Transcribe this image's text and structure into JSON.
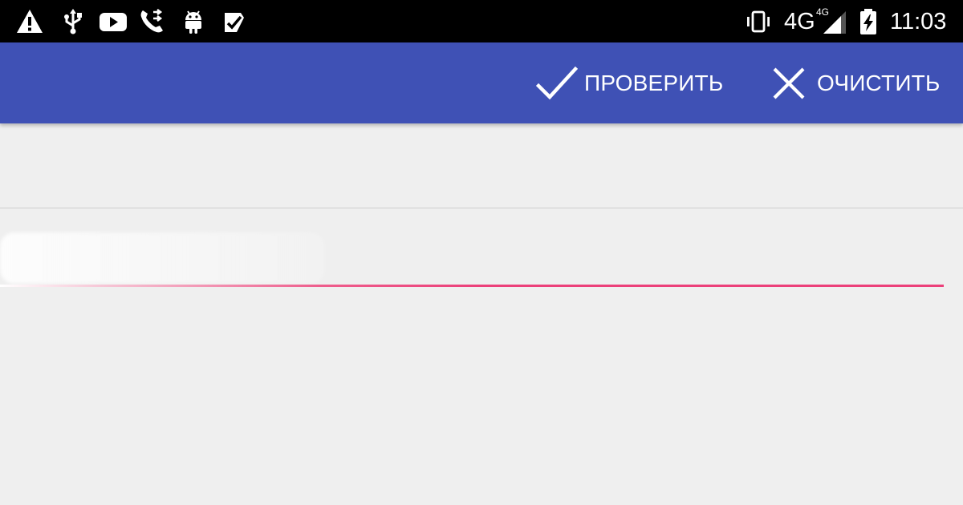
{
  "status_bar": {
    "network_label": "4G",
    "network_small_label": "4G",
    "time": "11:03",
    "icons": [
      "warning-icon",
      "usb-icon",
      "youtube-icon",
      "phone-forward-icon",
      "android-icon",
      "tasks-icon",
      "vibrate-icon",
      "signal-icon",
      "battery-charging-icon"
    ]
  },
  "toolbar": {
    "check_label": "ПРОВЕРИТЬ",
    "clear_label": "ОЧИСТИТЬ",
    "background_color": "#3f51b5"
  },
  "form": {
    "input_value": "",
    "accent_color": "#ec407a"
  }
}
